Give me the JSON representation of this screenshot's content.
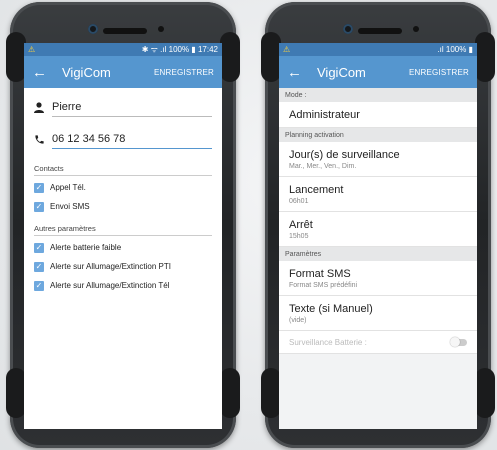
{
  "left_phone": {
    "status": {
      "warning": "⚠",
      "icons": "✱ ᯤ .ıl",
      "battery": "100%",
      "time": "17:42"
    },
    "appbar": {
      "back": "←",
      "title": "VigiCom",
      "action": "ENREGISTRER"
    },
    "name_field": {
      "icon": "person-icon",
      "value": "Pierre"
    },
    "phone_field": {
      "icon": "phone-icon",
      "value": "06 12 34 56 78"
    },
    "contacts_header": "Contacts",
    "contacts": [
      {
        "label": "Appel Tél.",
        "checked": true
      },
      {
        "label": "Envoi SMS",
        "checked": true
      }
    ],
    "other_header": "Autres paramètres",
    "other": [
      {
        "label": "Alerte batterie faible",
        "checked": true
      },
      {
        "label": "Alerte sur Allumage/Extinction PTI",
        "checked": true
      },
      {
        "label": "Alerte sur Allumage/Extinction Tél",
        "checked": true
      }
    ]
  },
  "right_phone": {
    "status": {
      "warning": "⚠",
      "icons": ".ıl",
      "battery": "100%"
    },
    "appbar": {
      "back": "←",
      "title": "VigiCom",
      "action": "ENREGISTRER"
    },
    "mode_header": "Mode :",
    "mode_value": "Administrateur",
    "planning_header": "Planning activation",
    "days": {
      "title": "Jour(s) de surveillance",
      "sub": "Mar., Mer., Ven., Dim."
    },
    "start": {
      "title": "Lancement",
      "sub": "06h01"
    },
    "stop": {
      "title": "Arrêt",
      "sub": "15h05"
    },
    "params_header": "Paramètres",
    "sms_format": {
      "title": "Format SMS",
      "sub": "Format SMS prédéfini"
    },
    "text_manual": {
      "title": "Texte (si Manuel)",
      "sub": "(vide)"
    },
    "battery_watch": {
      "title": "Surveillance Batterie :",
      "enabled": false
    }
  }
}
